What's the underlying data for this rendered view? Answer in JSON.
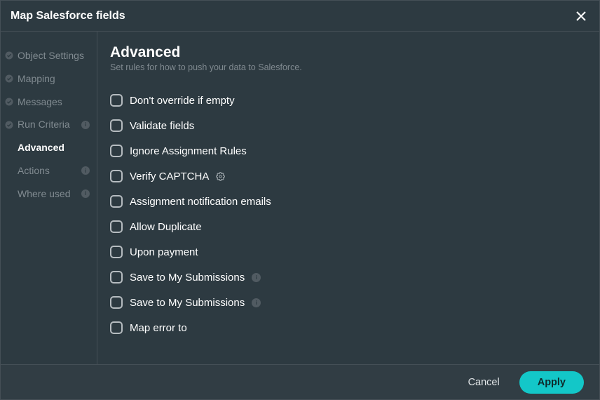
{
  "modal": {
    "title": "Map Salesforce fields"
  },
  "sidebar": {
    "items": [
      {
        "label": "Object Settings",
        "completed": true,
        "info": false,
        "active": false
      },
      {
        "label": "Mapping",
        "completed": true,
        "info": false,
        "active": false
      },
      {
        "label": "Messages",
        "completed": true,
        "info": false,
        "active": false
      },
      {
        "label": "Run Criteria",
        "completed": true,
        "info": true,
        "active": false
      },
      {
        "label": "Advanced",
        "completed": false,
        "info": false,
        "active": true
      },
      {
        "label": "Actions",
        "completed": false,
        "info": true,
        "active": false
      },
      {
        "label": "Where used",
        "completed": false,
        "info": true,
        "active": false
      }
    ]
  },
  "panel": {
    "heading": "Advanced",
    "subtitle": "Set rules for how to push your data to Salesforce.",
    "options": [
      {
        "label": "Don't override if empty",
        "info": false,
        "gear": false
      },
      {
        "label": "Validate fields",
        "info": false,
        "gear": false
      },
      {
        "label": "Ignore Assignment Rules",
        "info": false,
        "gear": false
      },
      {
        "label": "Verify CAPTCHA",
        "info": false,
        "gear": true
      },
      {
        "label": "Assignment notification emails",
        "info": false,
        "gear": false
      },
      {
        "label": "Allow Duplicate",
        "info": false,
        "gear": false
      },
      {
        "label": "Upon payment",
        "info": false,
        "gear": false
      },
      {
        "label": "Save to My Submissions",
        "info": true,
        "gear": false
      },
      {
        "label": "Save to My Submissions",
        "info": true,
        "gear": false
      },
      {
        "label": "Map error to",
        "info": false,
        "gear": false
      }
    ]
  },
  "footer": {
    "cancel": "Cancel",
    "apply": "Apply"
  }
}
